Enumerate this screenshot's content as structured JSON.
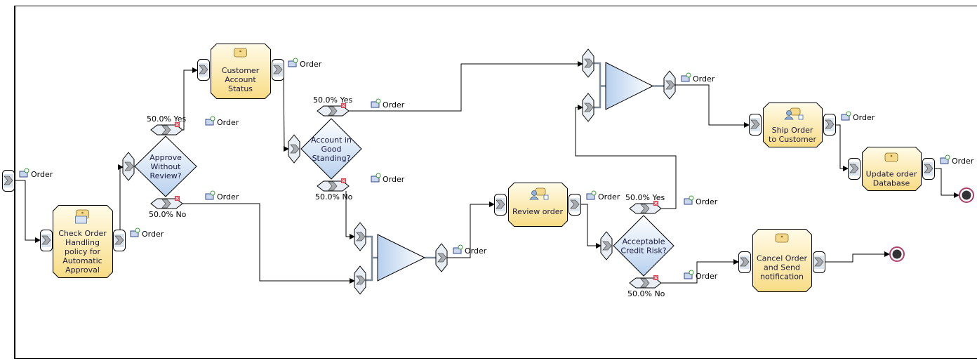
{
  "colors": {
    "task_fill_top": "#fffbe8",
    "task_fill_bottom": "#f8dd88",
    "gateway_fill_top": "#ffffff",
    "gateway_fill_bottom": "#b9d2ef",
    "connector": "#000000",
    "port_fill": "#e8eef4",
    "end_event": "#b0406a"
  },
  "data_label": "Order",
  "tasks": [
    {
      "id": "check",
      "lines": [
        "Check Order",
        "Handling",
        "policy for",
        "Automatic",
        "Approval"
      ],
      "icon": "business-rule-task-icon"
    },
    {
      "id": "cust",
      "lines": [
        "Customer",
        "Account",
        "Status"
      ],
      "icon": "task-icon"
    },
    {
      "id": "review",
      "lines": [
        "Review order"
      ],
      "icon": "human-task-icon"
    },
    {
      "id": "ship",
      "lines": [
        "Ship Order",
        "to Customer"
      ],
      "icon": "human-task-icon"
    },
    {
      "id": "update",
      "lines": [
        "Update order",
        "Database"
      ],
      "icon": "task-icon"
    },
    {
      "id": "cancel",
      "lines": [
        "Cancel Order",
        "and Send",
        "notification"
      ],
      "icon": "task-icon"
    }
  ],
  "decisions": [
    {
      "id": "approve",
      "lines": [
        "Approve",
        "Without",
        "Review?"
      ],
      "yes": "50.0% Yes",
      "no": "50.0% No"
    },
    {
      "id": "account",
      "lines": [
        "Account in",
        "Good",
        "Standing?"
      ],
      "yes": "50.0% Yes",
      "no": "50.0% No"
    },
    {
      "id": "credit",
      "lines": [
        "Acceptable",
        "Credit Risk?"
      ],
      "yes": "50.0% Yes",
      "no": "50.0% No"
    }
  ],
  "merges": [
    {
      "id": "merge1"
    },
    {
      "id": "merge2"
    }
  ],
  "end_events": [
    {
      "id": "end1"
    },
    {
      "id": "end2"
    }
  ]
}
